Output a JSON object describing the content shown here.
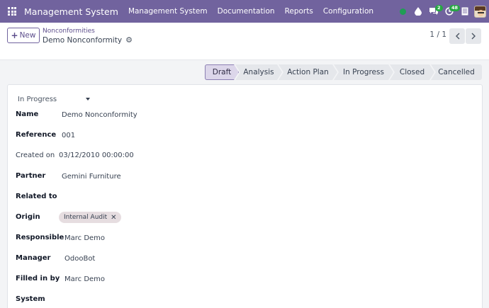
{
  "navbar": {
    "apps_icon": "grid-icon",
    "brand": "Management System",
    "menu": [
      "Management System",
      "Documentation",
      "Reports",
      "Configuration"
    ],
    "systray": {
      "status_dot_color": "#1f9d55",
      "messages_badge": "2",
      "activities_badge": "48"
    }
  },
  "control": {
    "new_label": "New",
    "breadcrumb": "Nonconformities",
    "record_title": "Demo Nonconformity",
    "pager": "1 / 1"
  },
  "statusbar": {
    "stages": [
      "Draft",
      "Analysis",
      "Action Plan",
      "In Progress",
      "Closed",
      "Cancelled"
    ],
    "active": "Draft"
  },
  "form": {
    "state": "In Progress",
    "fields": {
      "name": {
        "label": "Name",
        "value": "Demo Nonconformity"
      },
      "reference": {
        "label": "Reference",
        "value": "001"
      },
      "created_on": {
        "label": "Created on",
        "value": "03/12/2010 00:00:00"
      },
      "partner": {
        "label": "Partner",
        "value": "Gemini Furniture"
      },
      "related_to": {
        "label": "Related to",
        "value": ""
      },
      "origin": {
        "label": "Origin",
        "tag": "Internal Audit"
      },
      "responsible": {
        "label": "Responsible",
        "value": "Marc Demo"
      },
      "manager": {
        "label": "Manager",
        "value": "OdooBot"
      },
      "filled_in_by": {
        "label": "Filled in by",
        "value": "Marc Demo"
      },
      "system": {
        "label": "System",
        "value": ""
      }
    }
  }
}
